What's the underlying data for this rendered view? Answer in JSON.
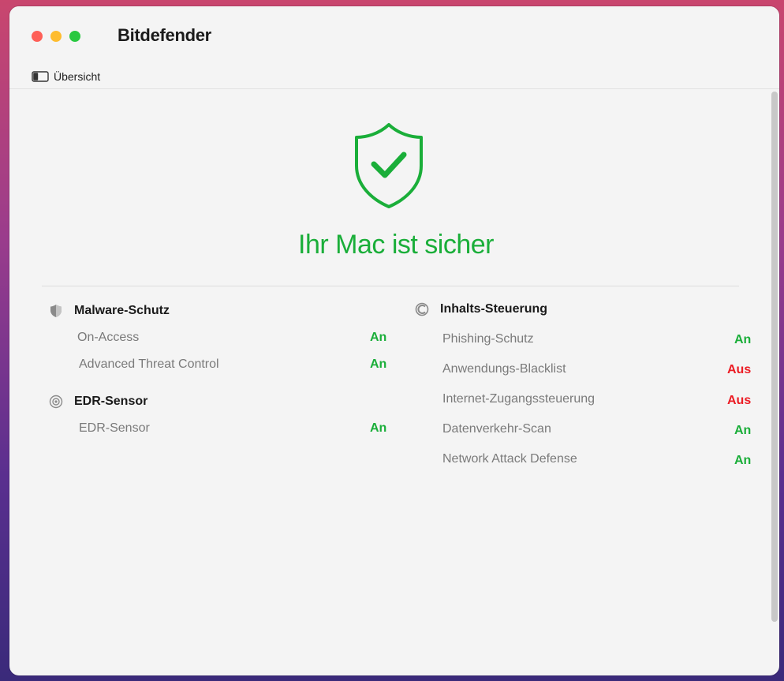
{
  "app": {
    "brand": "Bitdefender"
  },
  "toolbar": {
    "sidebar_label": "Übersicht"
  },
  "status": {
    "headline": "Ihr Mac ist sicher"
  },
  "left": {
    "sections": [
      {
        "title": "Malware-Schutz",
        "icon": "shield-icon",
        "items": [
          {
            "label": "On-Access",
            "value": "An"
          },
          {
            "label": "Advanced Threat Control",
            "value": "An"
          }
        ]
      },
      {
        "title": "EDR-Sensor",
        "icon": "edr-icon",
        "items": [
          {
            "label": "EDR-Sensor",
            "value": "An"
          }
        ]
      }
    ]
  },
  "right": {
    "sections": [
      {
        "title": "Inhalts-Steuerung",
        "icon": "content-control-icon",
        "items": [
          {
            "label": "Phishing-Schutz",
            "value": "An"
          },
          {
            "label": "Anwendungs-Blacklist",
            "value": "Aus"
          },
          {
            "label": "Internet-Zugangssteuerung",
            "value": "Aus"
          },
          {
            "label": "Datenverkehr-Scan",
            "value": "An"
          },
          {
            "label": "Network Attack Defense",
            "value": "An"
          }
        ]
      }
    ]
  },
  "colors": {
    "on": "#1aae39",
    "off": "#ec1c24",
    "accent": "#1aae39"
  }
}
